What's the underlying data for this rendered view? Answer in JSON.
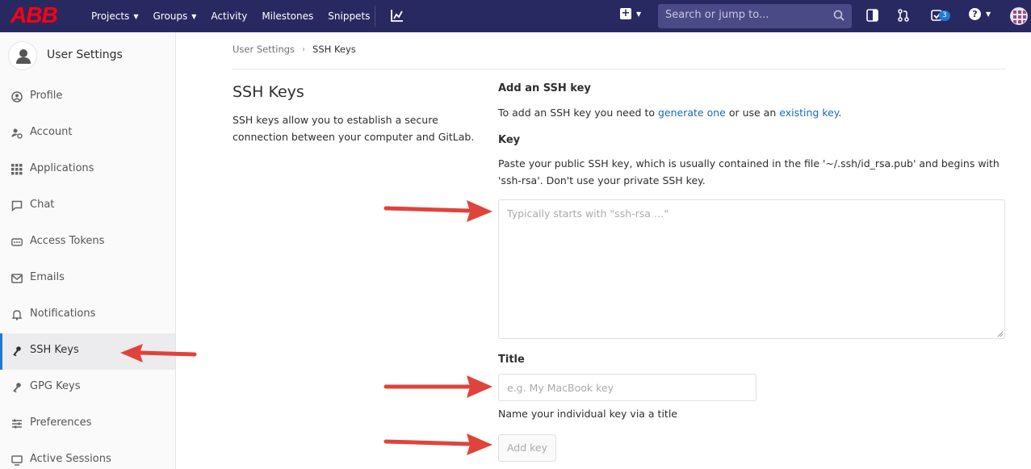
{
  "brand": {
    "logo_text": "ABB",
    "logo_color": "#ff000f",
    "nav_bg": "#292961"
  },
  "nav": {
    "links": [
      "Projects",
      "Groups",
      "Activity",
      "Milestones",
      "Snippets"
    ],
    "search_placeholder": "Search or jump to...",
    "todo_count": "3"
  },
  "sidebar": {
    "title": "User Settings",
    "items": [
      {
        "label": "Profile",
        "icon": "profile-icon"
      },
      {
        "label": "Account",
        "icon": "account-gear-icon"
      },
      {
        "label": "Applications",
        "icon": "applications-grid-icon"
      },
      {
        "label": "Chat",
        "icon": "chat-icon"
      },
      {
        "label": "Access Tokens",
        "icon": "token-icon"
      },
      {
        "label": "Emails",
        "icon": "envelope-icon"
      },
      {
        "label": "Notifications",
        "icon": "bell-icon"
      },
      {
        "label": "SSH Keys",
        "icon": "key-icon",
        "active": true
      },
      {
        "label": "GPG Keys",
        "icon": "key-icon"
      },
      {
        "label": "Preferences",
        "icon": "sliders-icon"
      },
      {
        "label": "Active Sessions",
        "icon": "sessions-icon"
      }
    ]
  },
  "breadcrumb": {
    "parent": "User Settings",
    "current": "SSH Keys"
  },
  "page": {
    "title": "SSH Keys",
    "description": "SSH keys allow you to establish a secure connection between your computer and GitLab."
  },
  "form": {
    "add_heading": "Add an SSH key",
    "intro_prefix": "To add an SSH key you need to ",
    "intro_link1": "generate one",
    "intro_middle": " or use an ",
    "intro_link2": "existing key",
    "intro_suffix": ".",
    "key_label": "Key",
    "key_help": "Paste your public SSH key, which is usually contained in the file '~/.ssh/id_rsa.pub' and begins with 'ssh-rsa'. Don't use your private SSH key.",
    "key_placeholder": "Typically starts with \"ssh-rsa …\"",
    "title_label": "Title",
    "title_placeholder": "e.g. My MacBook key",
    "title_help": "Name your individual key via a title",
    "add_button": "Add key"
  },
  "colors": {
    "link": "#1b69b6",
    "annotation_arrow": "#e0433b",
    "active_border": "#1f78d1"
  }
}
